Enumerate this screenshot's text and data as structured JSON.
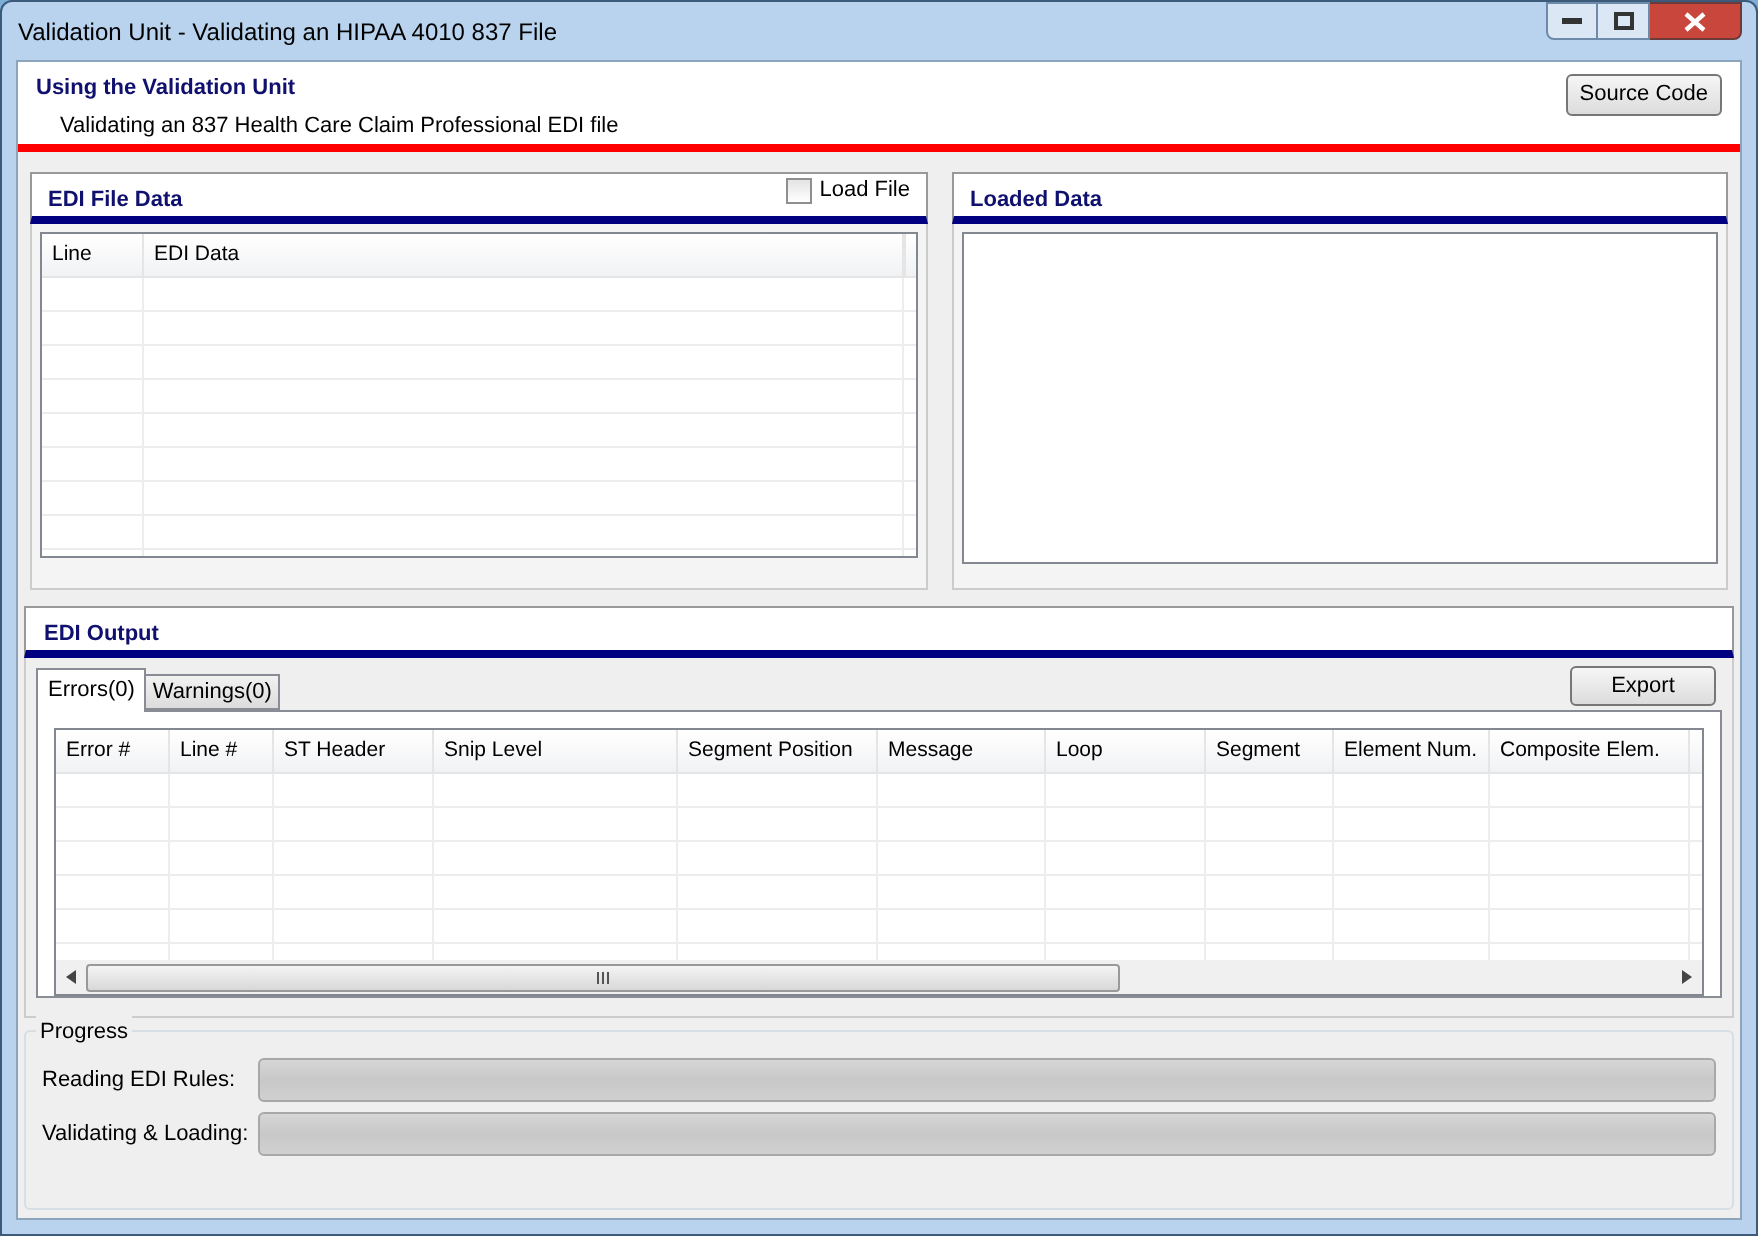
{
  "window": {
    "title": "Validation Unit - Validating an HIPAA 4010 837 File"
  },
  "header": {
    "title": "Using the Validation Unit",
    "subtitle": "Validating an 837 Health Care Claim Professional EDI file",
    "button": "Source Code"
  },
  "edi_file_data": {
    "title": "EDI File Data",
    "load_file": {
      "label": "Load File",
      "checked": false
    },
    "columns": [
      "Line",
      "EDI Data"
    ]
  },
  "loaded_data": {
    "title": "Loaded Data"
  },
  "edi_output": {
    "title": "EDI Output",
    "tabs": [
      {
        "label": "Errors(0)",
        "selected": true
      },
      {
        "label": "Warnings(0)",
        "selected": false
      }
    ],
    "button": "Export",
    "columns": [
      "Error #",
      "Line #",
      "ST Header",
      "Snip Level",
      "Segment Position",
      "Message",
      "Loop",
      "Segment",
      "Element Num.",
      "Composite Elem."
    ]
  },
  "progress": {
    "title": "Progress",
    "bars": [
      {
        "label": "Reading EDI Rules:",
        "level": 0
      },
      {
        "label": "Validating & Loading:",
        "level": 0
      }
    ]
  }
}
